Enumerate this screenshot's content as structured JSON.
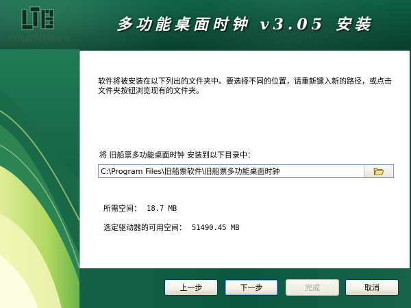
{
  "window": {
    "title": "多功能桌面时钟 v3.05 安装",
    "logo_url": "www.jcpl0686.com"
  },
  "page": {
    "instructions": "软件将被安装在以下列出的文件夹中。要选择不同的位置，请重新键入新的路径，或点击文件夹按钮浏览现有的文件夹。",
    "install_target_label": "将 旧船票多功能桌面时钟 安装到以下目录中：",
    "install_path": "C:\\Program Files\\旧船票软件\\旧船票多功能桌面时钟",
    "browse_icon": "folder-open-icon",
    "required_space_label": "所需空间：",
    "required_space_value": "18.7 MB",
    "available_space_label": "选定驱动器的可用空间：",
    "available_space_value": "51490.45 MB"
  },
  "buttons": {
    "back": "上一步",
    "next": "下一步",
    "finish": "完成",
    "cancel": "取消"
  },
  "colors": {
    "brand_green": "#0b5a40",
    "panel_white": "#ffffff",
    "title_text": "#ffffff"
  }
}
